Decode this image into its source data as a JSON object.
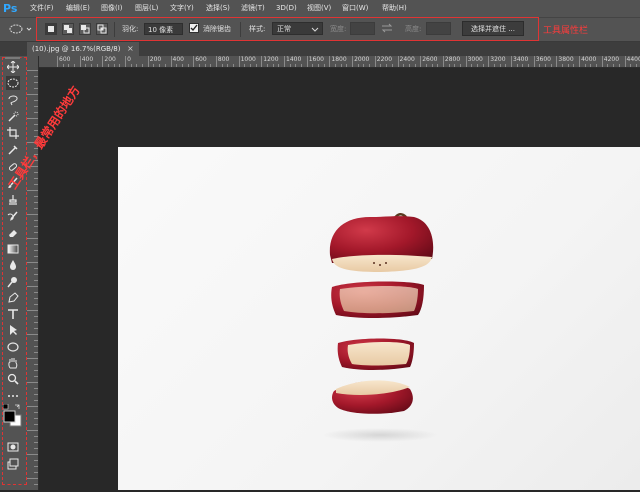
{
  "app": {
    "logo": "Ps"
  },
  "menu": [
    "文件(F)",
    "编辑(E)",
    "图像(I)",
    "图层(L)",
    "文字(Y)",
    "选择(S)",
    "滤镜(T)",
    "3D(D)",
    "视图(V)",
    "窗口(W)",
    "帮助(H)"
  ],
  "options": {
    "feather_label": "羽化:",
    "feather_value": "10 像素",
    "antialias_label": "消除锯齿",
    "style_label": "样式:",
    "style_value": "正常",
    "width_label": "宽度:",
    "height_label": "高度:",
    "select_mask_button": "选择并遮住 ..."
  },
  "annotations": {
    "options_bar": "工具属性栏",
    "toolbar": "工具栏，最常用的地方"
  },
  "document": {
    "tab_title": "(10).jpg @ 16.7%(RGB/8)",
    "close": "×"
  },
  "ruler_labels": [
    "600",
    "400",
    "200",
    "0",
    "200",
    "400",
    "600",
    "800",
    "1000",
    "1200",
    "1400",
    "1600",
    "1800",
    "2000",
    "2200",
    "2400",
    "2600",
    "2800",
    "3000",
    "3200",
    "3400",
    "3600",
    "3800",
    "4000",
    "4200",
    "4400"
  ],
  "colors": {
    "ui_dark": "#535353",
    "workspace": "#282828",
    "annotation_red": "#e03434",
    "ps_blue": "#31a8ff",
    "apple_red": "#a3182a",
    "apple_flesh": "#f3dcc0"
  },
  "tools": [
    "move-icon",
    "marquee-icon",
    "lasso-icon",
    "quick-select-icon",
    "crop-icon",
    "eyedropper-icon",
    "healing-brush-icon",
    "brush-icon",
    "clone-stamp-icon",
    "history-brush-icon",
    "eraser-icon",
    "gradient-icon",
    "blur-icon",
    "dodge-icon",
    "pen-icon",
    "type-icon",
    "path-select-icon",
    "ellipse-shape-icon",
    "hand-icon",
    "zoom-icon",
    "more-tools-icon",
    "color-swatches-icon",
    "quick-mask-icon",
    "screen-mode-icon"
  ]
}
